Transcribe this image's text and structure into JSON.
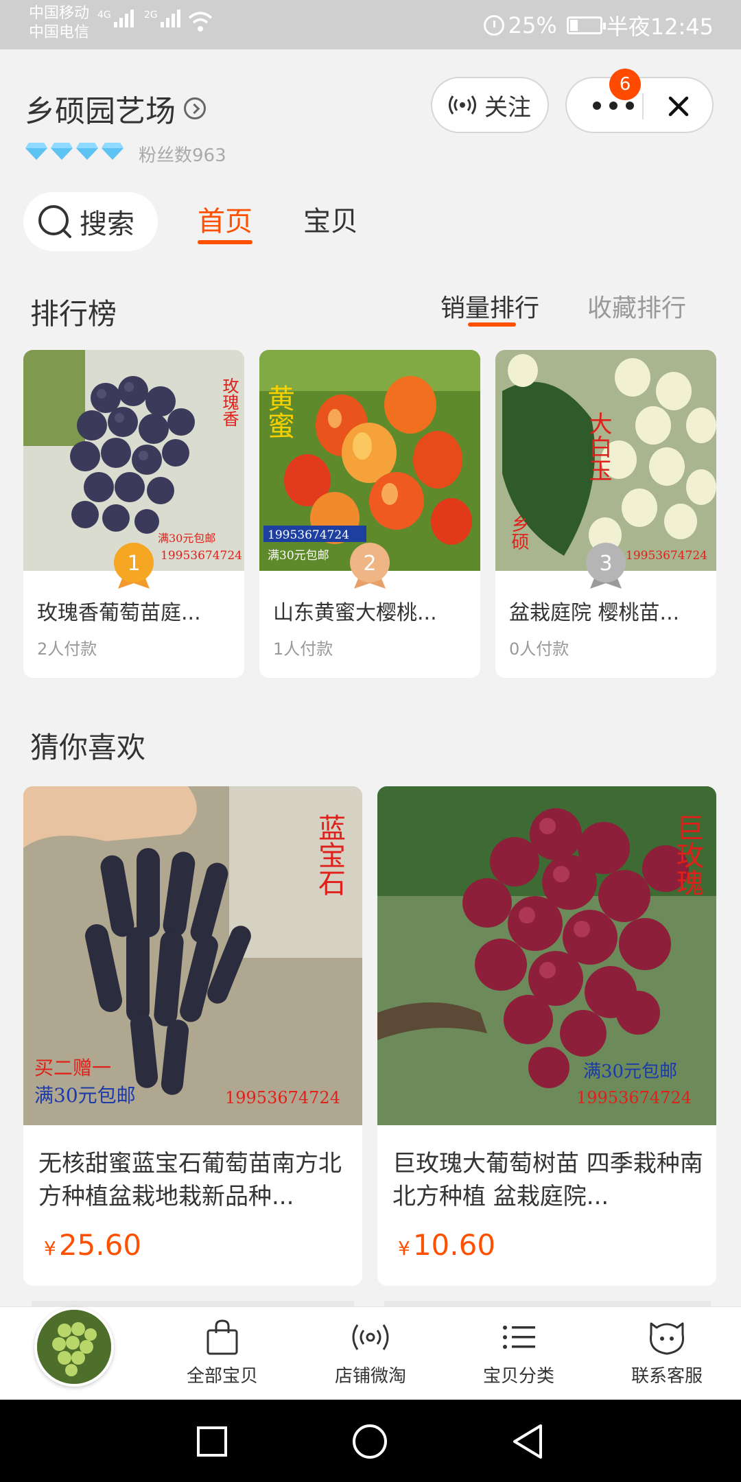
{
  "status_bar": {
    "carrier_1": "中国移动",
    "carrier_2": "中国电信",
    "net_1": "4G",
    "net_2": "2G",
    "battery": "25%",
    "time": "半夜12:45"
  },
  "shop": {
    "name": "乡硕园艺场",
    "fans": "粉丝数963",
    "follow_label": "关注",
    "badge_count": "6"
  },
  "tabs": {
    "search": "搜索",
    "home": "首页",
    "items": "宝贝"
  },
  "ranking": {
    "title": "排行榜",
    "sort_sales": "销量排行",
    "sort_fav": "收藏排行",
    "cards": [
      {
        "rank": "1",
        "title": "玫瑰香葡萄苗庭...",
        "paid": "2人付款",
        "img_tag": "玫瑰香",
        "phone": "19953674724",
        "promo": "满30元包邮"
      },
      {
        "rank": "2",
        "title": "山东黄蜜大樱桃...",
        "paid": "1人付款",
        "img_tag": "黄蜜",
        "phone": "19953674724",
        "promo": "满30元包邮"
      },
      {
        "rank": "3",
        "title": "盆栽庭院 樱桃苗...",
        "paid": "0人付款",
        "img_tag": "大白玉",
        "img_tag2": "乡硕",
        "phone": "19953674724"
      }
    ]
  },
  "recommend": {
    "title": "猜你喜欢",
    "cards": [
      {
        "title": "无核甜蜜蓝宝石葡萄苗南方北方种植盆栽地栽新品种...",
        "currency": "¥",
        "price": "25.60",
        "img_tag": "蓝宝石",
        "promo_1": "买二赠一",
        "promo_2": "满30元包邮",
        "phone": "19953674724"
      },
      {
        "title": "巨玫瑰大葡萄树苗 四季栽种南北方种植 盆栽庭院...",
        "currency": "¥",
        "price": "10.60",
        "img_tag": "巨玫瑰",
        "promo": "满30元包邮",
        "phone": "19953674724"
      }
    ]
  },
  "bottom_nav": {
    "all_items": "全部宝贝",
    "weitao": "店铺微淘",
    "category": "宝贝分类",
    "service": "联系客服"
  },
  "colors": {
    "accent": "#ff5000",
    "diamond": "#5cc3f2"
  }
}
